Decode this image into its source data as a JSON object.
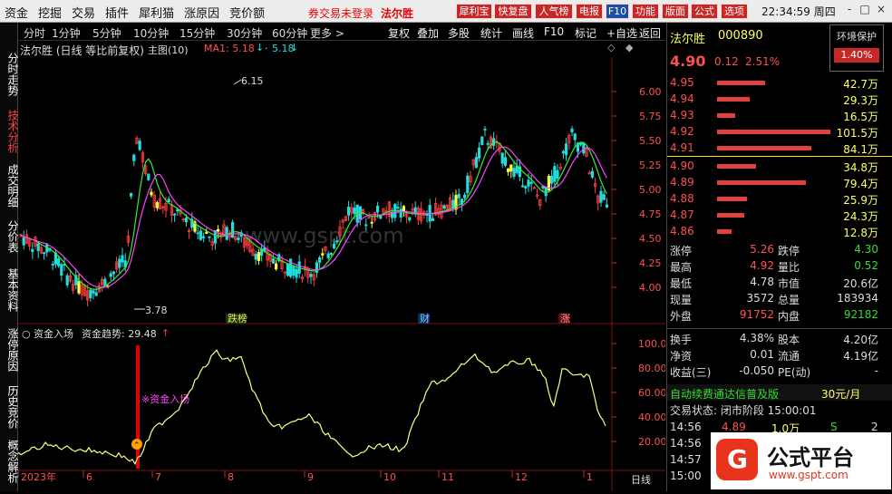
{
  "topbar": {
    "menu": [
      "资金",
      "挖掘",
      "交易",
      "插件",
      "犀利猫",
      "涨原因",
      "竞价额"
    ],
    "login": "券交易未登录",
    "brand": "法尔胜",
    "buttons": [
      "犀利宝",
      "快复盘",
      "人气榜",
      "电报",
      "F10",
      "功能",
      "版面",
      "公式",
      "选项"
    ],
    "clock": "22:34:59 周四",
    "window_controls": [
      "-",
      "□",
      "×"
    ]
  },
  "sidebar": [
    "分时走势",
    "技术分析",
    "成交明细",
    "分价表",
    "基本资料",
    "涨停原因",
    "历史竞价",
    "概念解析"
  ],
  "toolbar": {
    "periods": [
      "分时",
      "1分钟",
      "5分钟",
      "10分钟",
      "15分钟",
      "30分钟",
      "60分钟",
      "更多 >"
    ],
    "actions": [
      "复权",
      "叠加",
      "多股",
      "统计",
      "画线",
      "F10",
      "标记",
      "+自选",
      "返回"
    ]
  },
  "chart_title": {
    "stock": "法尔胜 (日线 等比前复权)",
    "main": "主图(10)",
    "ma1": "MA1: 5.18",
    "ma2": "5.18"
  },
  "price_axis": [
    "6.00",
    "5.75",
    "5.50",
    "5.25",
    "5.00",
    "4.75",
    "4.50",
    "4.25",
    "4.00"
  ],
  "annotations": {
    "high": "6.15",
    "low": "3.78",
    "event1": "跌榜",
    "event2": "财",
    "event3": "涨"
  },
  "indicator": {
    "title": "资金入场",
    "trend_label": "资金趋势: 29.48",
    "axis": [
      "100.00",
      "80.00",
      "60.00",
      "40.00",
      "20.00"
    ],
    "signal": "※资金入场"
  },
  "x_axis": [
    "2023年",
    "6",
    "7",
    "8",
    "9",
    "10",
    "11",
    "12",
    "1"
  ],
  "period_label": "日线",
  "quote": {
    "name": "法尔胜",
    "code": "000890",
    "tag": "环境保护",
    "price": "4.90",
    "change": "0.12",
    "change_pct": "2.51%",
    "tag_pct": "1.40%",
    "asks": [
      {
        "price": "4.95",
        "vol": "42.7万",
        "frac": 0.42
      },
      {
        "price": "4.94",
        "vol": "29.3万",
        "frac": 0.29
      },
      {
        "price": "4.93",
        "vol": "16.5万",
        "frac": 0.16
      },
      {
        "price": "4.92",
        "vol": "101.5万",
        "frac": 1.0
      },
      {
        "price": "4.91",
        "vol": "84.1万",
        "frac": 0.83
      }
    ],
    "bids": [
      {
        "price": "4.90",
        "vol": "34.8万",
        "frac": 0.34
      },
      {
        "price": "4.89",
        "vol": "79.4万",
        "frac": 0.78
      },
      {
        "price": "4.88",
        "vol": "25.9万",
        "frac": 0.26
      },
      {
        "price": "4.87",
        "vol": "24.3万",
        "frac": 0.24
      },
      {
        "price": "4.86",
        "vol": "12.8万",
        "frac": 0.13
      }
    ],
    "stats": [
      {
        "l1": "涨停",
        "v1": "5.26",
        "l2": "跌停",
        "v2": "4.30",
        "c1": "#ff5050",
        "c2": "#33dd33"
      },
      {
        "l1": "最高",
        "v1": "4.92",
        "l2": "量比",
        "v2": "0.52",
        "c1": "#ff5050",
        "c2": "#33dd33"
      },
      {
        "l1": "最低",
        "v1": "4.78",
        "l2": "市值",
        "v2": "20.6亿",
        "c1": "#dddddd",
        "c2": "#dddddd"
      },
      {
        "l1": "现量",
        "v1": "3572",
        "l2": "总量",
        "v2": "183934",
        "c1": "#dddddd",
        "c2": "#dddddd"
      },
      {
        "l1": "外盘",
        "v1": "91752",
        "l2": "内盘",
        "v2": "92182",
        "c1": "#ff5050",
        "c2": "#33dd33"
      },
      {
        "l1": "换手",
        "v1": "4.38%",
        "l2": "股本",
        "v2": "4.20亿",
        "c1": "#dddddd",
        "c2": "#dddddd"
      },
      {
        "l1": "净资",
        "v1": "0.01",
        "l2": "流通",
        "v2": "4.19亿",
        "c1": "#dddddd",
        "c2": "#dddddd"
      },
      {
        "l1": "收益(三)",
        "v1": "-0.050",
        "l2": "PE(动)",
        "v2": "-",
        "c1": "#dddddd",
        "c2": "#dddddd"
      }
    ],
    "promo": "自动续费通达信普及版",
    "promo_price": "30元/月",
    "trade_status": "交易状态: 闭市阶段 15:00:01",
    "ticks": [
      {
        "time": "14:56",
        "price": "4.89",
        "vol": "1.0万",
        "side": "S",
        "n": "2"
      },
      {
        "time": "14:56",
        "price": "",
        "vol": "",
        "side": "",
        "n": ""
      },
      {
        "time": "14:57",
        "price": "",
        "vol": "",
        "side": "",
        "n": ""
      },
      {
        "time": "15:00",
        "price": "",
        "vol": "",
        "side": "",
        "n": ""
      }
    ]
  },
  "logo": {
    "text": "公式平台",
    "url": "www.gspt.com"
  },
  "watermark": "www.gspt.com",
  "colors": {
    "up": "#ff3b3b",
    "down": "#22dddd",
    "ma": "#ff44ff",
    "trend": "#ffff80",
    "accent": "#ffff00"
  }
}
